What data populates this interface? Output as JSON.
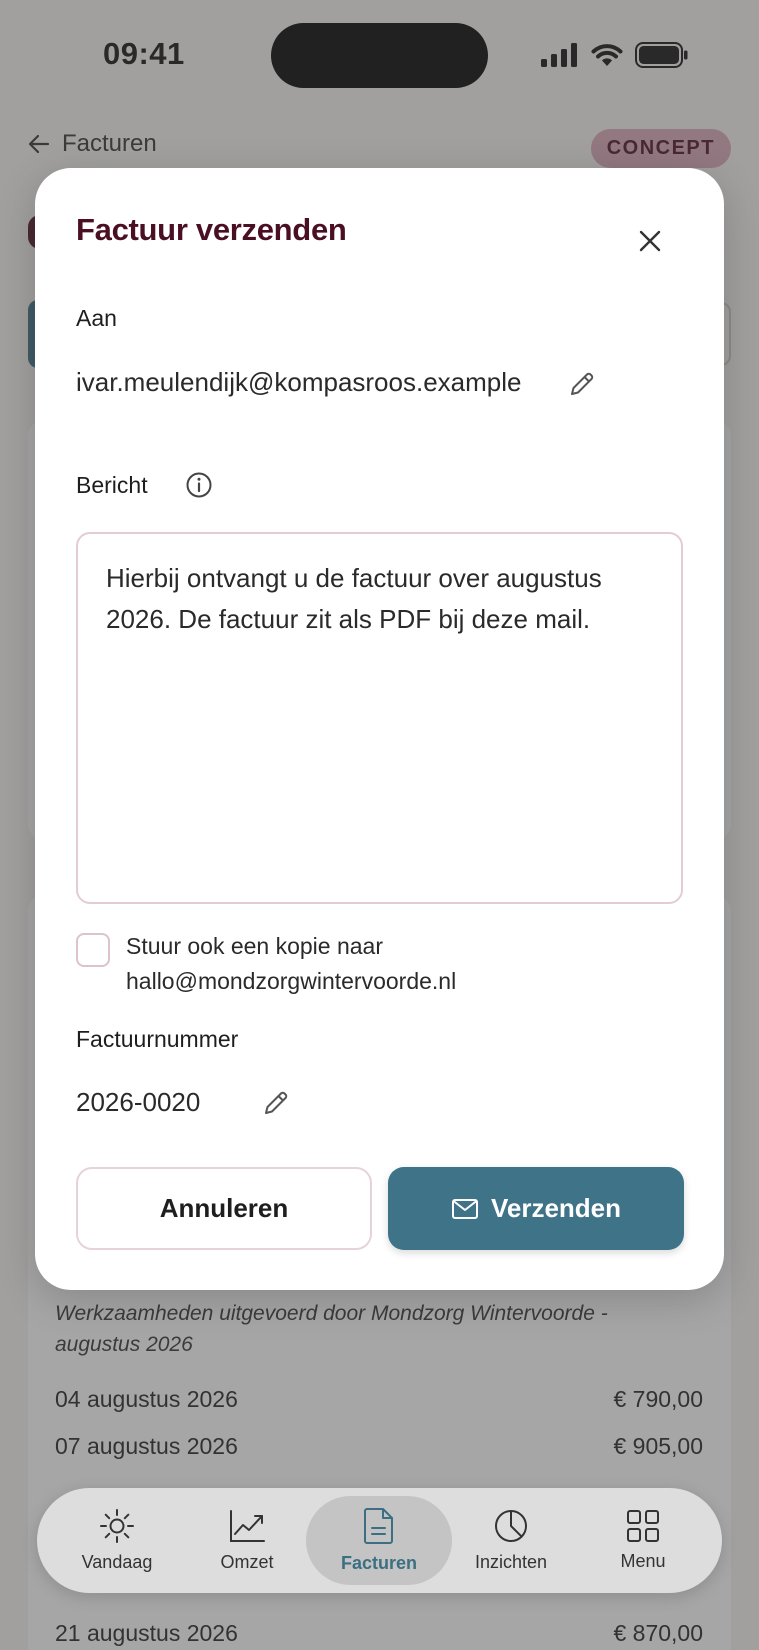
{
  "status_bar": {
    "time": "09:41"
  },
  "header": {
    "back_label": "Facturen",
    "status_badge": "CONCEPT"
  },
  "modal": {
    "title": "Factuur verzenden",
    "to_label": "Aan",
    "to_value": "ivar.meulendijk@kompasroos.example",
    "message_label": "Bericht",
    "message_value": "Hierbij ontvangt u de factuur over augustus 2026. De factuur zit als PDF bij deze mail.",
    "copy_checkbox_checked": false,
    "copy_label_line1": "Stuur ook een kopie naar",
    "copy_label_line2": "hallo@mondzorgwintervoorde.nl",
    "invoice_number_label": "Factuurnummer",
    "invoice_number_value": "2026-0020",
    "cancel_label": "Annuleren",
    "send_label": "Verzenden"
  },
  "invoice": {
    "description": "Werkzaamheden uitgevoerd door Mondzorg Wintervoorde - augustus 2026",
    "rows": [
      {
        "date": "04 augustus 2026",
        "amount": "€ 790,00"
      },
      {
        "date": "07 augustus 2026",
        "amount": "€ 905,00"
      },
      {
        "date": "21 augustus 2026",
        "amount": "€ 870,00"
      }
    ]
  },
  "tabbar": {
    "tabs": [
      {
        "label": "Vandaag",
        "icon": "sun-icon"
      },
      {
        "label": "Omzet",
        "icon": "chart-line-icon"
      },
      {
        "label": "Facturen",
        "icon": "document-icon",
        "active": true
      },
      {
        "label": "Inzichten",
        "icon": "pie-chart-icon"
      },
      {
        "label": "Menu",
        "icon": "grid-icon"
      }
    ]
  },
  "colors": {
    "primary": "#3f7387",
    "brand_dark": "#4a0f22",
    "badge_bg": "#d9a7b6",
    "active_tab": "#3d6f82"
  }
}
